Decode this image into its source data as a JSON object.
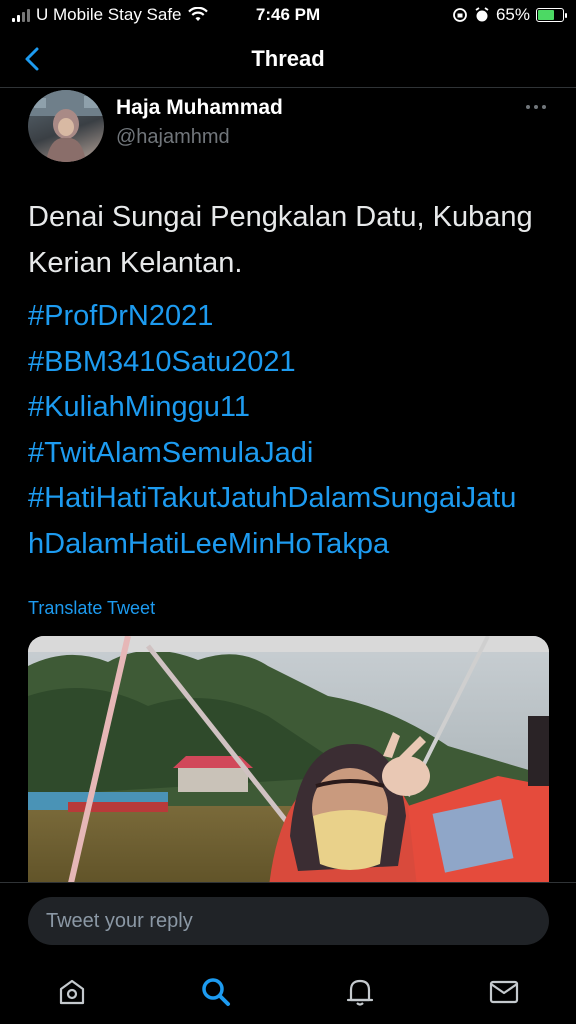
{
  "status_bar": {
    "carrier": "U Mobile Stay Safe",
    "time": "7:46 PM",
    "battery_percent": "65%",
    "battery_level": 0.65
  },
  "header": {
    "title": "Thread",
    "back_icon": "chevron-left-icon"
  },
  "tweet": {
    "author_name": "Haja Muhammad",
    "author_handle": "@hajamhmd",
    "text": "Denai Sungai Pengkalan Datu, Kubang Kerian Kelantan.",
    "hashtags": [
      "#ProfDrN2021",
      "#BBM3410Satu2021",
      "#KuliahMinggu11",
      "#TwitAlamSemulaJadi",
      "#HatiHatiTakutJatuhDalamSungaiJatu",
      "hDalamHatiLeeMinHoTakpa"
    ],
    "translate_label": "Translate Tweet",
    "more_icon": "more-horizontal-icon"
  },
  "reply": {
    "placeholder": "Tweet your reply"
  },
  "tab_bar": {
    "items": [
      "home-icon",
      "search-icon",
      "notifications-icon",
      "messages-icon"
    ],
    "active": "search-icon"
  },
  "colors": {
    "accent": "#1d9bf0",
    "background": "#000000",
    "battery_fill": "#4cd964"
  }
}
